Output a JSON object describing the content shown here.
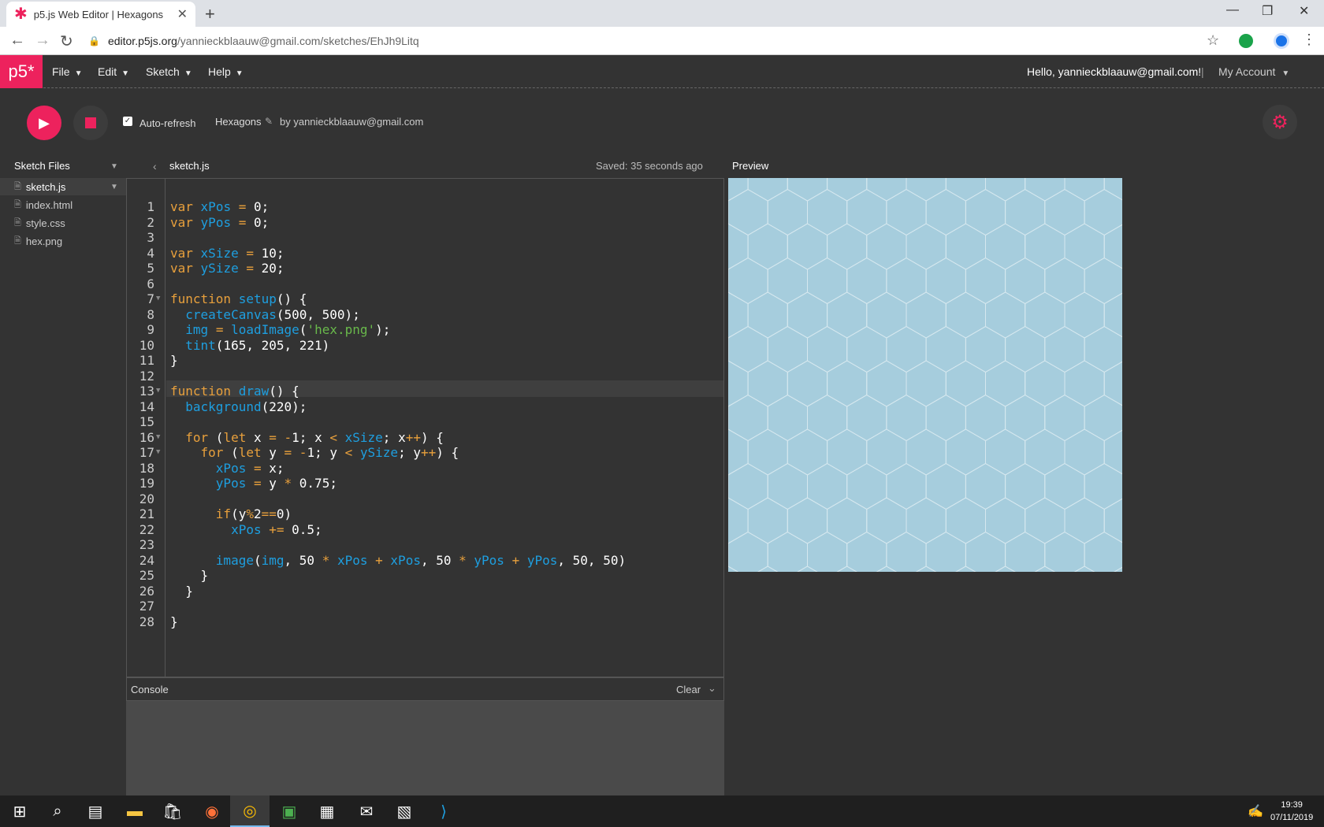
{
  "browser": {
    "tab_title": "p5.js Web Editor | Hexagons",
    "url_host": "editor.p5js.org",
    "url_path": "/yannieckblaauw@gmail.com/sketches/EhJh9Litq"
  },
  "menubar": {
    "logo": "p5*",
    "items": [
      "File",
      "Edit",
      "Sketch",
      "Help"
    ],
    "greeting": "Hello, yannieckblaauw@gmail.com!",
    "account": "My Account"
  },
  "toolbar": {
    "auto_refresh": "Auto-refresh",
    "auto_refresh_checked": true,
    "sketch_name": "Hexagons",
    "byline": "by yannieckblaauw@gmail.com"
  },
  "sidebar": {
    "title": "Sketch Files",
    "files": [
      "sketch.js",
      "index.html",
      "style.css",
      "hex.png"
    ],
    "selected": "sketch.js"
  },
  "editor": {
    "filename": "sketch.js",
    "saved": "Saved: 35 seconds ago",
    "lines": [
      "var xPos = 0;",
      "var yPos = 0;",
      "",
      "var xSize = 10;",
      "var ySize = 20;",
      "",
      "function setup() {",
      "  createCanvas(500, 500);",
      "  img = loadImage('hex.png');",
      "  tint(165, 205, 221)",
      "}",
      "",
      "function draw() {",
      "  background(220);",
      "",
      "  for (let x = -1; x < xSize; x++) {",
      "    for (let y = -1; y < ySize; y++) {",
      "      xPos = x;",
      "      yPos = y * 0.75;",
      "",
      "      if(y%2==0)",
      "        xPos += 0.5;",
      "",
      "      image(img, 50 * xPos + xPos, 50 * yPos + yPos, 50, 50)",
      "    }",
      "  }",
      "",
      "}"
    ],
    "fold_lines": [
      7,
      13,
      16,
      17
    ]
  },
  "console": {
    "title": "Console",
    "clear": "Clear"
  },
  "preview": {
    "title": "Preview",
    "bg_color": "#a6cddd",
    "line_color": "#d6e8ef"
  },
  "taskbar": {
    "time": "19:39",
    "date": "07/11/2019"
  },
  "colors": {
    "accent": "#ed225d"
  }
}
